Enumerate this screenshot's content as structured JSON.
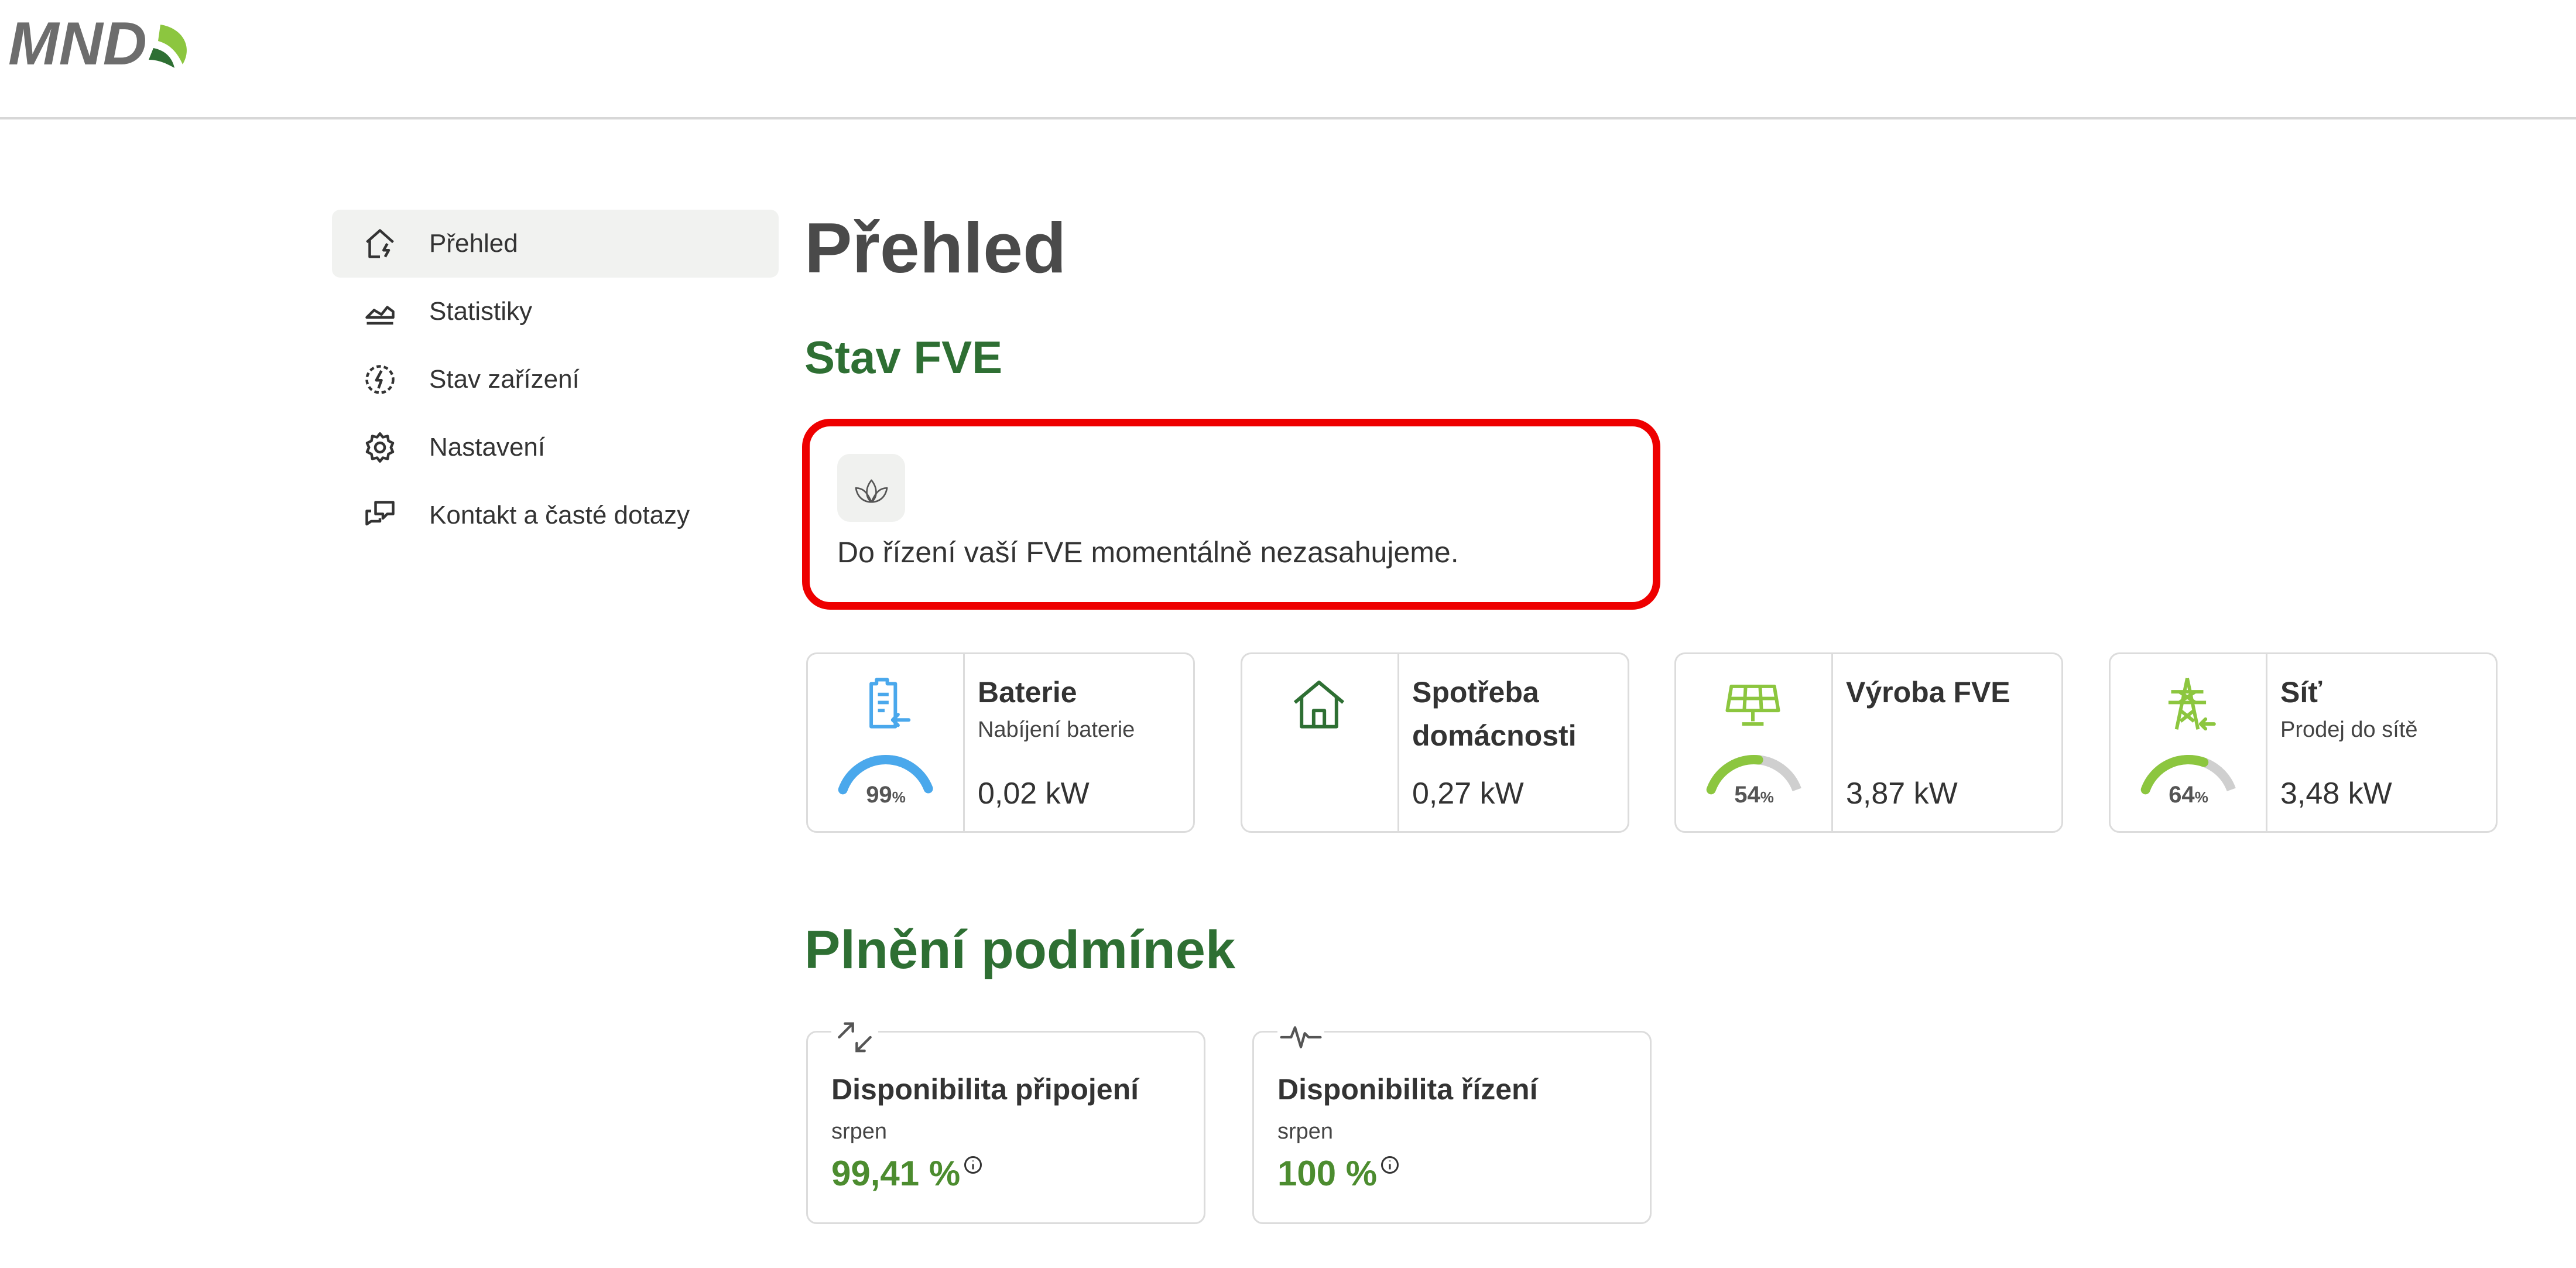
{
  "header": {
    "logo_text": "MND"
  },
  "colors": {
    "brand_green": "#2e6f33",
    "accent_green": "#8cc63f",
    "battery_blue": "#4aa8ec",
    "highlight_red": "#ee0000",
    "value_green": "#4c8c2f"
  },
  "sidebar": {
    "items": [
      {
        "label": "Přehled",
        "icon": "home-bolt-icon",
        "active": true
      },
      {
        "label": "Statistiky",
        "icon": "area-chart-icon",
        "active": false
      },
      {
        "label": "Stav zařízení",
        "icon": "device-status-icon",
        "active": false
      },
      {
        "label": "Nastavení",
        "icon": "gear-icon",
        "active": false
      },
      {
        "label": "Kontakt a časté dotazy",
        "icon": "chat-bubbles-icon",
        "active": false
      }
    ]
  },
  "main": {
    "title": "Přehled",
    "stav_fve": {
      "heading": "Stav FVE",
      "status_icon": "leaf-icon",
      "status_text": "Do řízení vaší FVE momentálně nezasahujeme."
    },
    "cards": [
      {
        "title": "Baterie",
        "subtitle": "Nabíjení baterie",
        "value": "0,02 kW",
        "icon": "battery-charging-icon",
        "gauge_percent": 99,
        "gauge_label": "99",
        "gauge_unit": "%"
      },
      {
        "title_line1": "Spotřeba",
        "title_line2": "domácnosti",
        "value": "0,27 kW",
        "icon": "house-icon"
      },
      {
        "title": "Výroba FVE",
        "value": "3,87 kW",
        "icon": "solar-panel-icon",
        "gauge_percent": 54,
        "gauge_label": "54",
        "gauge_unit": "%"
      },
      {
        "title": "Síť",
        "subtitle": "Prodej do sítě",
        "value": "3,48 kW",
        "icon": "power-pylon-icon",
        "gauge_percent": 64,
        "gauge_label": "64",
        "gauge_unit": "%"
      }
    ],
    "conditions": {
      "heading": "Plnění podmínek",
      "cards": [
        {
          "title": "Disponibilita připojení",
          "subtitle": "srpen",
          "value": "99,41 %",
          "icon": "connection-arrows-icon"
        },
        {
          "title": "Disponibilita řízení",
          "subtitle": "srpen",
          "value": "100 %",
          "icon": "pulse-icon"
        }
      ]
    }
  }
}
